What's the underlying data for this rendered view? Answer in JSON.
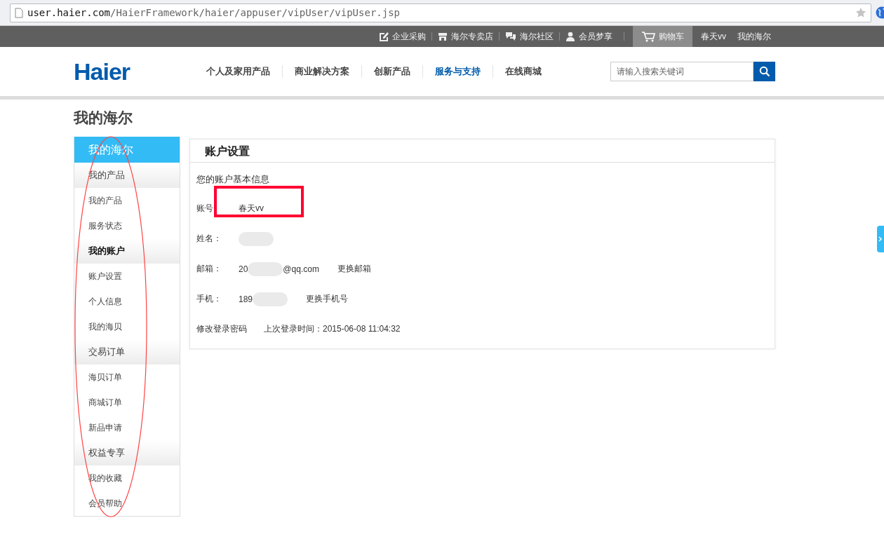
{
  "browser": {
    "url_host": "user.haier.com",
    "url_path": "/HaierFramework/haier/appuser/vipUser/vipUser.jsp"
  },
  "top_bar": {
    "links": [
      {
        "label": "企业采购",
        "kind": "edit",
        "selected": false
      },
      {
        "label": "海尔专卖店",
        "kind": "store",
        "selected": false
      },
      {
        "label": "海尔社区",
        "kind": "chat",
        "selected": false
      },
      {
        "label": "会员梦享",
        "kind": "user",
        "selected": false
      },
      {
        "label": "购物车",
        "kind": "cart",
        "selected": true
      },
      {
        "label": "春天vv",
        "kind": "plain",
        "selected": false
      },
      {
        "label": "我的海尔",
        "kind": "plain",
        "selected": false
      }
    ]
  },
  "header": {
    "logo": "Haier",
    "nav": [
      {
        "label": "个人及家用产品",
        "selected": false
      },
      {
        "label": "商业解决方案",
        "selected": false
      },
      {
        "label": "创新产品",
        "selected": false
      },
      {
        "label": "服务与支持",
        "selected": true
      },
      {
        "label": "在线商城",
        "selected": false
      }
    ],
    "search": {
      "placeholder": "请输入搜索关键词"
    }
  },
  "page_title": "我的海尔",
  "sidebar": {
    "title": "我的海尔",
    "groups": [
      {
        "label": "我的产品",
        "selected": false,
        "children": [
          {
            "label": "我的产品"
          },
          {
            "label": "服务状态"
          }
        ]
      },
      {
        "label": "我的账户",
        "selected": true,
        "children": [
          {
            "label": "账户设置"
          },
          {
            "label": "个人信息"
          },
          {
            "label": "我的海贝"
          }
        ]
      },
      {
        "label": "交易订单",
        "selected": false,
        "children": [
          {
            "label": "海贝订单"
          },
          {
            "label": "商城订单"
          },
          {
            "label": "新品申请"
          }
        ]
      },
      {
        "label": "权益专享",
        "selected": false,
        "children": [
          {
            "label": "我的收藏"
          },
          {
            "label": "会员帮助"
          }
        ]
      }
    ]
  },
  "panel": {
    "title": "账户设置",
    "intro": "您的账户基本信息",
    "fields": [
      {
        "label": "账号",
        "value": "春天vv"
      },
      {
        "label": "姓名：",
        "redacted": true
      },
      {
        "label": "邮箱：",
        "value": "20",
        "redacted": true,
        "suffix": "@qq.com",
        "action": "更换邮箱"
      },
      {
        "label": "手机：",
        "value": "189",
        "redacted": true,
        "action": "更换手机号"
      }
    ],
    "footer": {
      "link": "修改登录密码",
      "last_login": "上次登录时间：2015-06-08 11:04:32"
    }
  },
  "annotations": {
    "account_box": true,
    "menu_ellipse": true
  }
}
